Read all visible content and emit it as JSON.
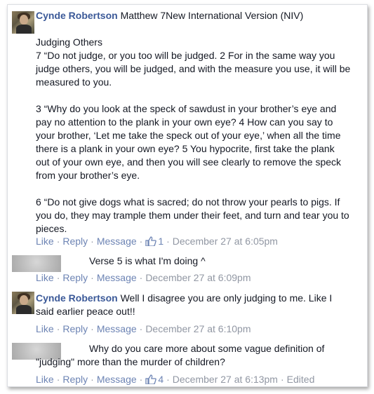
{
  "comments": [
    {
      "author": "Cynde Robertson",
      "text": "Matthew 7New International Version (NIV)\n\nJudging Others\n7 “Do not judge, or you too will be judged. 2 For in the same way you\njudge others, you will be judged, and with the measure you use, it will be\nmeasured to you.\n\n3 “Why do you look at the speck of sawdust in your brother’s eye and\npay no attention to the plank in your own eye? 4 How can you say to\nyour brother, ‘Let me take the speck out of your eye,’ when all the time\nthere is a plank in your own eye? 5 You hypocrite, first take the plank\nout of your own eye, and then you will see clearly to remove the speck\nfrom your brother’s eye.\n\n6 “Do not give dogs what is sacred; do not throw your pearls to pigs. If\nyou do, they may trample them under their feet, and turn and tear you to\npieces.",
      "like": "Like",
      "reply": "Reply",
      "message": "Message",
      "likes": "1",
      "time": "December 27 at 6:05pm"
    },
    {
      "author": "",
      "text": "Verse 5 is what I'm doing ^",
      "like": "Like",
      "reply": "Reply",
      "message": "Message",
      "time": "December 27 at 6:09pm"
    },
    {
      "author": "Cynde Robertson",
      "text": "Well I disagree you are only judging to me. Like I\nsaid earlier peace out!!",
      "like": "Like",
      "reply": "Reply",
      "message": "Message",
      "time": "December 27 at 6:10pm"
    },
    {
      "author": "",
      "text": "Why do you care more about some vague definition of\n\"judging\" more than the murder of children?",
      "like": "Like",
      "reply": "Reply",
      "message": "Message",
      "likes": "4",
      "time": "December 27 at 6:13pm",
      "edited": "Edited"
    }
  ],
  "separator": "·",
  "icons": {
    "like": "thumbs-up-icon"
  },
  "colors": {
    "author": "#3b5998",
    "link": "#6d84b4",
    "meta": "#9197a3",
    "body": "#141823"
  }
}
